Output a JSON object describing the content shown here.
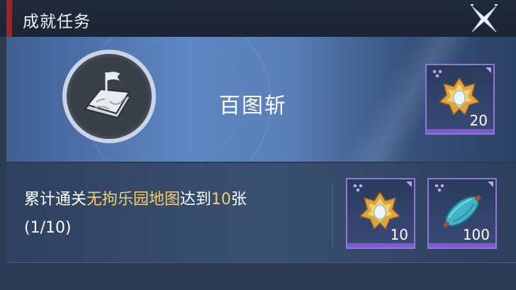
{
  "header": {
    "title": "成就任务",
    "close_icon": "close-x-icon"
  },
  "achievement": {
    "name": "百图斩",
    "badge_icon": "flag-map-icon",
    "reward": {
      "icon": "gold-crest-icon",
      "count": "20"
    }
  },
  "task": {
    "desc_prefix": "累计通关",
    "desc_highlight": "无拘乐园地图",
    "desc_mid": "达到",
    "desc_number": "10",
    "desc_suffix": "张",
    "progress": "(1/10)",
    "rewards": [
      {
        "icon": "gold-crest-icon",
        "count": "10"
      },
      {
        "icon": "teal-scroll-icon",
        "count": "100"
      }
    ]
  },
  "colors": {
    "accent_red": "#9b2626",
    "highlight_gold": "#f2cf75",
    "card_border": "#8b7bd6"
  }
}
